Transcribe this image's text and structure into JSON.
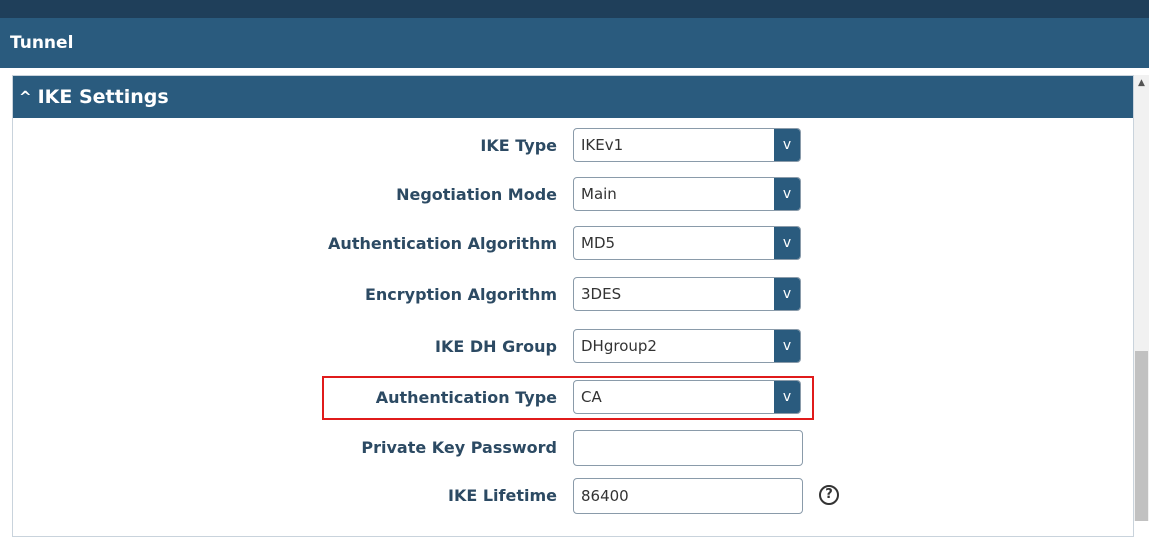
{
  "tunnel": {
    "title": "Tunnel"
  },
  "ike_settings": {
    "header": "IKE Settings",
    "fields": [
      {
        "label": "IKE Type",
        "value": "IKEv1",
        "control": "select"
      },
      {
        "label": "Negotiation Mode",
        "value": "Main",
        "control": "select"
      },
      {
        "label": "Authentication Algorithm",
        "value": "MD5",
        "control": "select"
      },
      {
        "label": "Encryption Algorithm",
        "value": "3DES",
        "control": "select"
      },
      {
        "label": "IKE DH Group",
        "value": "DHgroup2",
        "control": "select"
      },
      {
        "label": "Authentication Type",
        "value": "CA",
        "control": "select"
      },
      {
        "label": "Private Key Password",
        "value": "",
        "control": "input"
      },
      {
        "label": "IKE Lifetime",
        "value": "86400",
        "control": "input"
      }
    ],
    "dropdown_arrow": "v",
    "help_glyph": "?"
  },
  "colors": {
    "header_bg": "#2a5b7e",
    "label_text": "#2c4a63",
    "highlight": "#e01b1b"
  },
  "icons": {
    "collapse": "chevron-up-icon",
    "help": "help-circle-icon",
    "dropdown": "dropdown-arrow-icon"
  }
}
